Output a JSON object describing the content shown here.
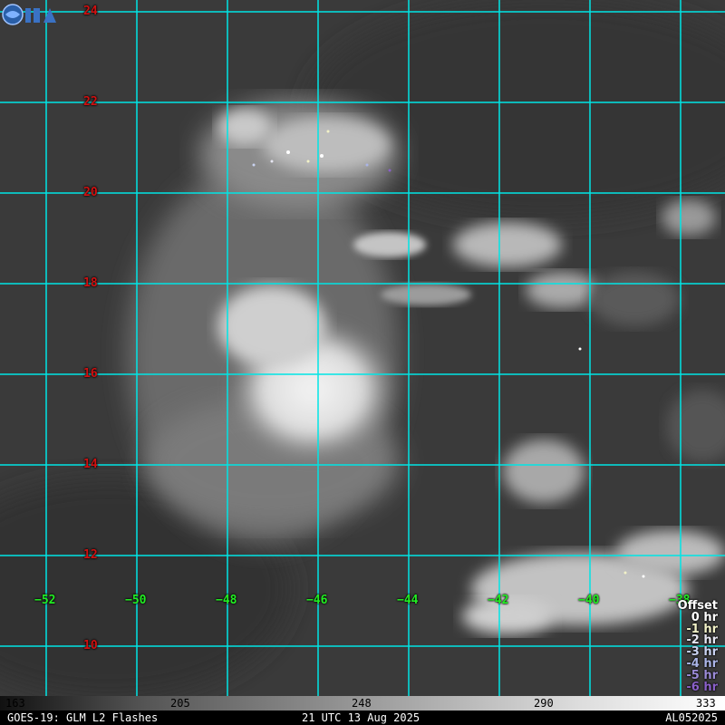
{
  "map": {
    "latitudes": [
      "24",
      "22",
      "20",
      "18",
      "16",
      "14",
      "12",
      "10"
    ],
    "longitudes": [
      "−52",
      "−50",
      "−48",
      "−46",
      "−44",
      "−42",
      "−40",
      "−38"
    ]
  },
  "legend": {
    "title": "Offset",
    "items": [
      {
        "label": "0 hr",
        "color": "#ffffff"
      },
      {
        "label": "-1 hr",
        "color": "#f2f2c8"
      },
      {
        "label": "-2 hr",
        "color": "#e6e6f2"
      },
      {
        "label": "-3 hr",
        "color": "#c8d2f0"
      },
      {
        "label": "-4 hr",
        "color": "#aab4e6"
      },
      {
        "label": "-5 hr",
        "color": "#9a8ad6"
      },
      {
        "label": "-6 hr",
        "color": "#8a60c8"
      }
    ]
  },
  "colorbar": {
    "ticks": [
      "163",
      "205",
      "248",
      "290",
      "333"
    ]
  },
  "status": {
    "product": "GOES-19: GLM L2 Flashes",
    "time": "21 UTC 13 Aug 2025",
    "storm_id": "AL052025"
  },
  "colors": {
    "grid": "#00e5e5",
    "lat_label": "#d01010",
    "lon_label": "#22ee22"
  }
}
